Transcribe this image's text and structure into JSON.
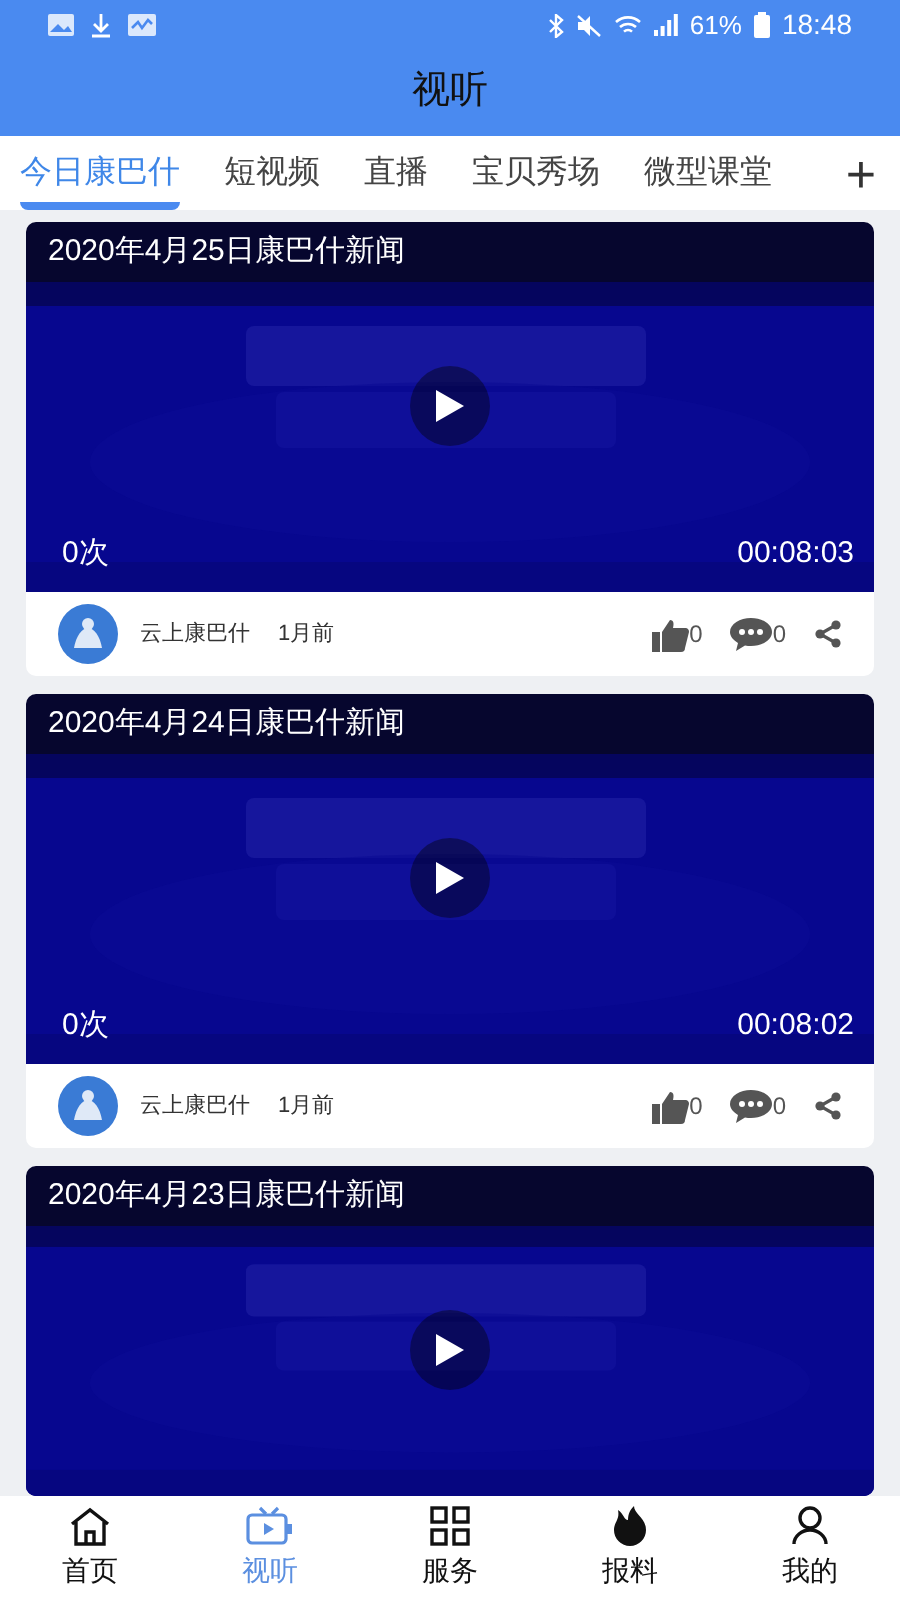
{
  "status_bar": {
    "battery": "61%",
    "time": "18:48"
  },
  "header": {
    "title": "视听"
  },
  "tabs": [
    {
      "label": "今日康巴什",
      "selected": true
    },
    {
      "label": "短视频",
      "selected": false
    },
    {
      "label": "直播",
      "selected": false
    },
    {
      "label": "宝贝秀场",
      "selected": false
    },
    {
      "label": "微型课堂",
      "selected": false
    }
  ],
  "add_tab": "+",
  "videos": [
    {
      "title": "2020年4月25日康巴什新闻",
      "views": "0次",
      "duration": "00:08:03",
      "source": "云上康巴什",
      "time": "1月前",
      "likes": "0",
      "comments": "0"
    },
    {
      "title": "2020年4月24日康巴什新闻",
      "views": "0次",
      "duration": "00:08:02",
      "source": "云上康巴什",
      "time": "1月前",
      "likes": "0",
      "comments": "0"
    },
    {
      "title": "2020年4月23日康巴什新闻"
    }
  ],
  "bottom_nav": [
    {
      "label": "首页",
      "selected": false
    },
    {
      "label": "视听",
      "selected": true
    },
    {
      "label": "服务",
      "selected": false
    },
    {
      "label": "报料",
      "selected": false
    },
    {
      "label": "我的",
      "selected": false
    }
  ]
}
